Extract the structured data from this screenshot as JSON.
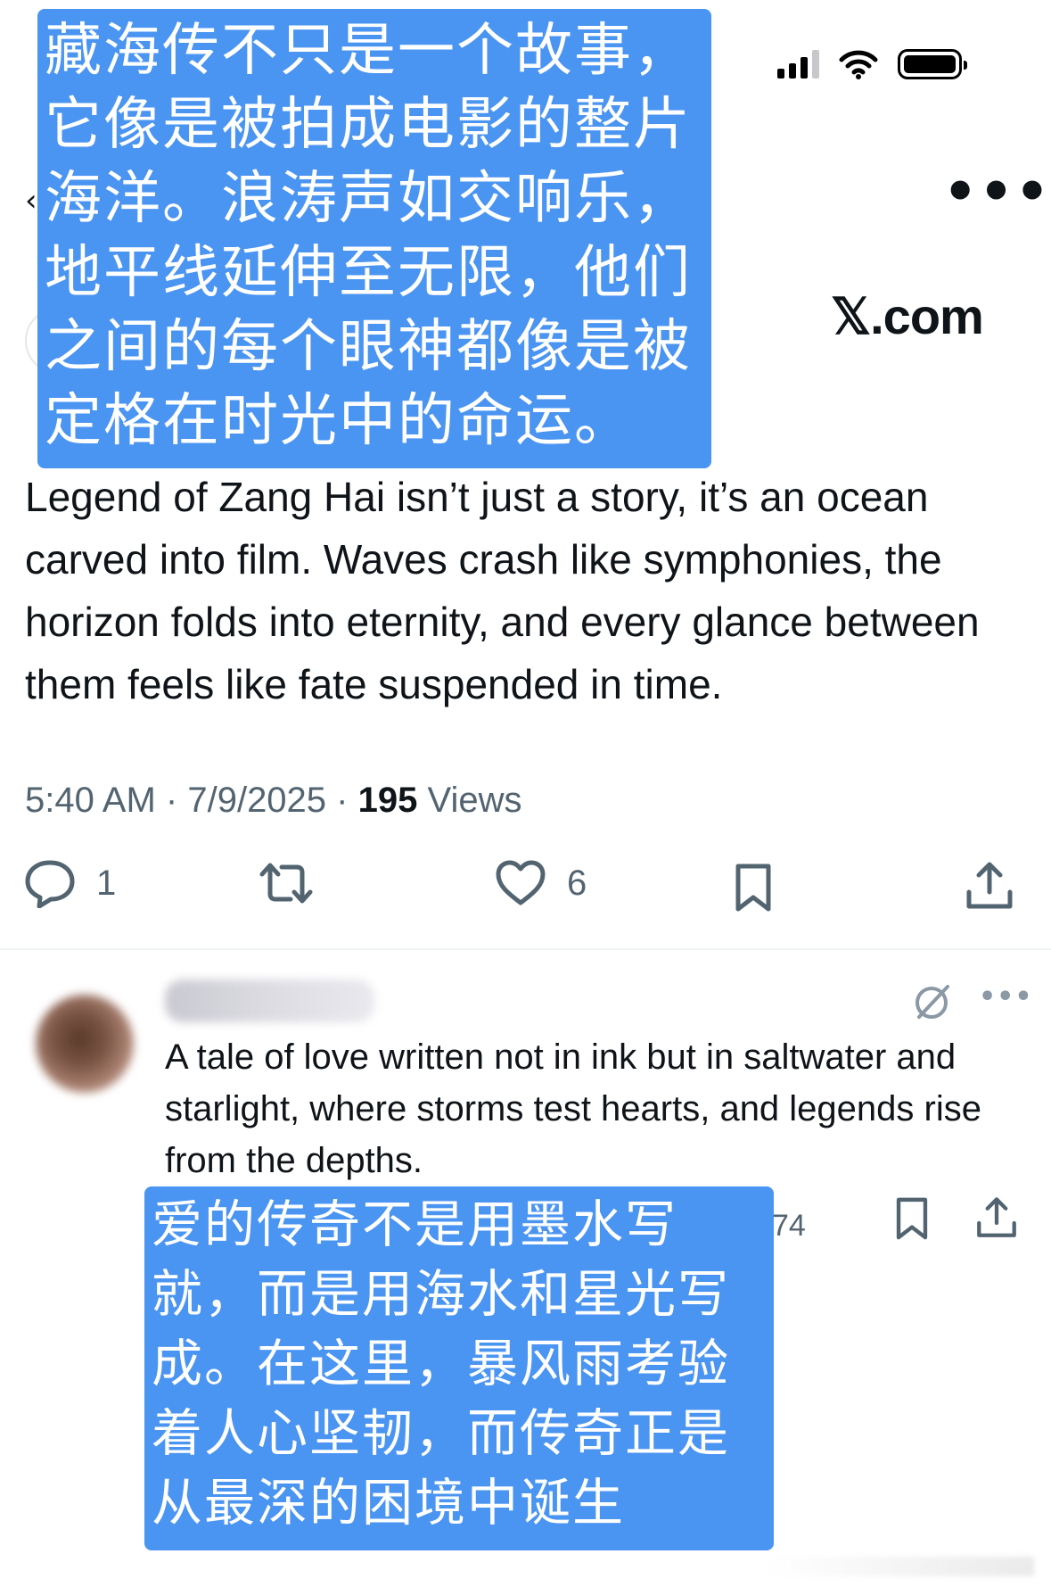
{
  "status_bar": {
    "signal_icon": "signal-icon",
    "wifi_icon": "wifi-icon",
    "battery_icon": "battery-icon"
  },
  "nav": {
    "back_glyph": "‹",
    "more_glyph": "•••"
  },
  "watermark": "𝕏.com",
  "overlay_top": {
    "lines": [
      "藏海传不只是一个故事，",
      "它像是被拍成电影的整片",
      "海洋。浪涛声如交响乐，",
      "地平线延伸至无限，他们",
      "之间的每个眼神都像是被",
      "定格在时光中的命运。"
    ]
  },
  "tweet": {
    "text": "Legend of Zang Hai isn’t just a story, it’s an ocean carved into film. Waves crash like symphonies, the horizon folds into eternity, and every glance between them feels like fate suspended in time.",
    "time": "5:40 AM",
    "date": "7/9/2025",
    "separator": "·",
    "views_count": "195",
    "views_label": "Views"
  },
  "actions": {
    "reply_count": "1",
    "repost_count": "",
    "like_count": "6"
  },
  "reply": {
    "text": "A tale of love written not in ink but in saltwater and starlight, where storms test hearts, and legends rise from the depths.",
    "views_partial": "74",
    "more_glyph": "•••"
  },
  "overlay_bottom": {
    "lines": [
      "爱的传奇不是用墨水写",
      "就，而是用海水和星光写",
      "成。在这里，暴风雨考验",
      "着人心坚韧，而传奇正是",
      "从最深的困境中诞生"
    ]
  },
  "colors": {
    "overlay_blue": "#4a94f2",
    "text_primary": "#0f1419",
    "text_secondary": "#536471"
  }
}
